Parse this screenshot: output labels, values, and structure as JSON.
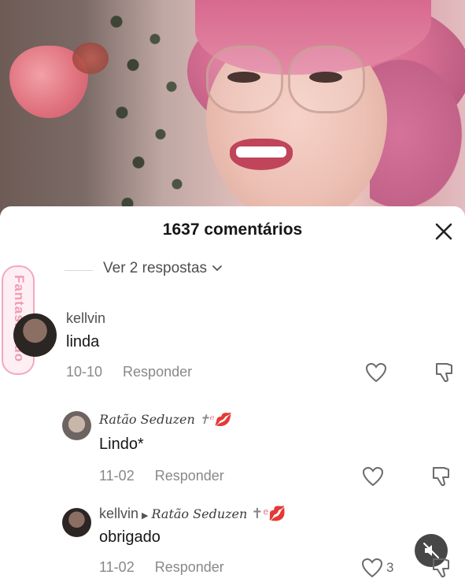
{
  "panel": {
    "title": "1637 comentários",
    "close_icon": "close-icon"
  },
  "thread": {
    "view_replies_label": "Ver 2 respostas"
  },
  "watermark": {
    "text": "Fantasiando"
  },
  "comments": [
    {
      "username": "kellvin",
      "text": "linda",
      "date": "10-10",
      "reply_label": "Responder"
    },
    {
      "username": "Ratão Seduzen",
      "text": "Lindo*",
      "date": "11-02",
      "reply_label": "Responder"
    },
    {
      "username": "kellvin",
      "reply_to": "Ratão Seduzen",
      "text": "obrigado",
      "date": "11-02",
      "reply_label": "Responder",
      "likes": "3"
    }
  ],
  "colors": {
    "text_primary": "#161616",
    "text_secondary": "#888888",
    "watermark": "#f29ab4"
  }
}
